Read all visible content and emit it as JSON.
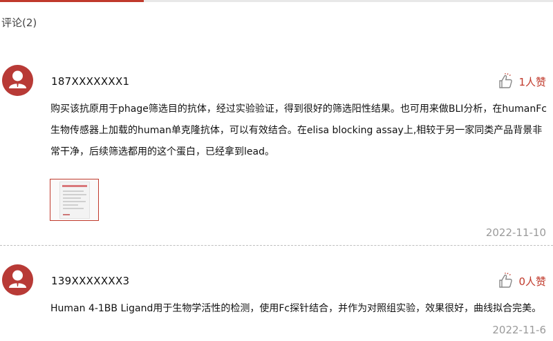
{
  "section": {
    "title": "评论(2)"
  },
  "colors": {
    "accent": "#c0392b",
    "avatar_bg": "#b83a36",
    "date": "#9a9a9a"
  },
  "comments": [
    {
      "user": "187XXXXXXX1",
      "likes": "1人赞",
      "text": "购买该抗原用于phage筛选目的抗体，经过实验验证，得到很好的筛选阳性结果。也可用来做BLI分析，在humanFc生物传感器上加载的human单克隆抗体，可以有效结合。在elisa blocking assay上,相较于另一家同类产品背景非常干净，后续筛选都用的这个蛋白，已经拿到lead。",
      "has_image": true,
      "date": "2022-11-10"
    },
    {
      "user": "139XXXXXXX3",
      "likes": "0人赞",
      "text": "Human 4-1BB Ligand用于生物学活性的检测，使用Fc探针结合，并作为对照组实验，效果很好，曲线拟合完美。",
      "has_image": false,
      "date": "2022-11-6"
    }
  ],
  "icons": {
    "avatar": "user-avatar-icon",
    "like": "thumbs-up-icon"
  }
}
